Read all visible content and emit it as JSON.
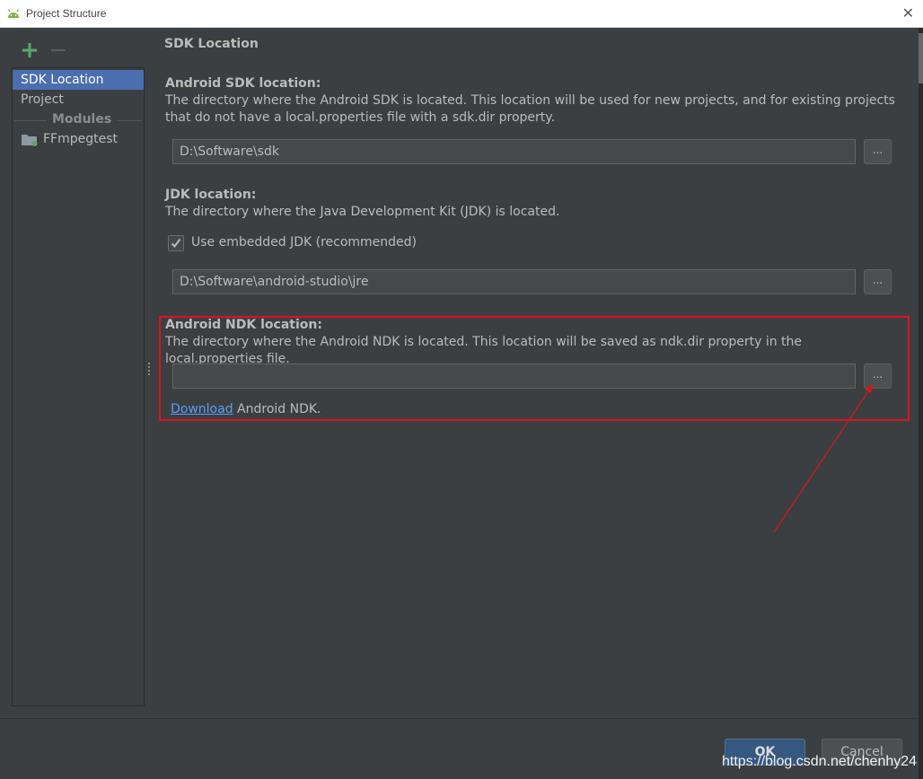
{
  "window": {
    "title": "Project Structure",
    "close_glyph": "✕"
  },
  "colors": {
    "accent": "#4b6eaf",
    "highlight_box": "#e0121f",
    "link": "#589df6",
    "add_icon": "#59a869"
  },
  "sidebar": {
    "items": [
      {
        "label": "SDK Location",
        "selected": true
      },
      {
        "label": "Project",
        "selected": false
      }
    ],
    "group_label": "Modules",
    "modules": [
      {
        "label": "FFmpegtest",
        "icon": "module-folder-icon"
      }
    ]
  },
  "main": {
    "page_title": "SDK Location",
    "android_sdk": {
      "title": "Android SDK location:",
      "description": "The directory where the Android SDK is located. This location will be used for new projects, and for existing projects that do not have a local.properties file with a sdk.dir property.",
      "path": "D:\\Software\\sdk",
      "browse_label": "..."
    },
    "jdk": {
      "title": "JDK location:",
      "description": "The directory where the Java Development Kit (JDK) is located.",
      "use_embedded_label": "Use embedded JDK (recommended)",
      "use_embedded_checked": true,
      "path": "D:\\Software\\android-studio\\jre",
      "browse_label": "..."
    },
    "ndk": {
      "title": "Android NDK location:",
      "description": "The directory where the Android NDK is located. This location will be saved as ndk.dir property in the local.properties file.",
      "path": "",
      "browse_label": "...",
      "download_link": "Download",
      "download_suffix": " Android NDK."
    }
  },
  "footer": {
    "ok_label": "OK",
    "cancel_label": "Cancel"
  },
  "watermark": "https://blog.csdn.net/chenhy24"
}
